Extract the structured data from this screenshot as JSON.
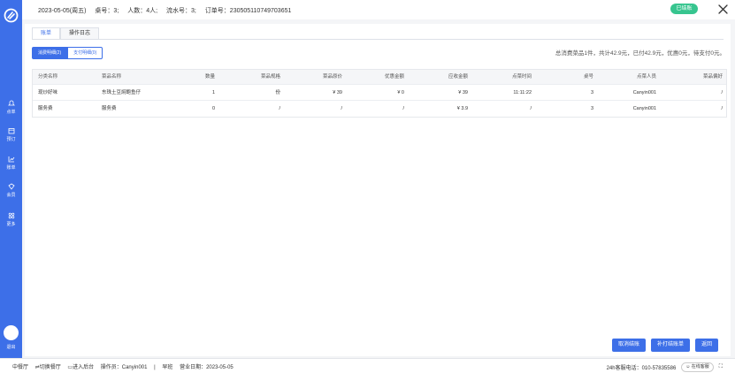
{
  "sidebar": {
    "items": [
      {
        "label": "点单",
        "icon": "bell-icon"
      },
      {
        "label": "预订",
        "icon": "calendar-icon"
      },
      {
        "label": "账单",
        "icon": "chart-icon"
      },
      {
        "label": "会员",
        "icon": "member-icon"
      },
      {
        "label": "更多",
        "icon": "grid-icon"
      }
    ],
    "logout": "退出"
  },
  "header": {
    "date": "2023-05-05(周五)",
    "table_no": "桌号：3;",
    "guests": "人数：4人;",
    "serial": "流水号：3;",
    "order_no": "订单号：230505110749703651",
    "status": "已结账"
  },
  "tabs": [
    "账单",
    "操作日志"
  ],
  "subtabs": [
    "消费明细(2)",
    "支付明细(0)"
  ],
  "summary": "总消费菜品1件，共计42.9元，已付42.9元，优惠0元，待支付0元。",
  "table": {
    "columns": [
      "分类名称",
      "菜品名称",
      "数量",
      "菜品规格",
      "菜品原价",
      "优惠金额",
      "应收金额",
      "点菜时间",
      "桌号",
      "点菜人员",
      "菜品偏好"
    ],
    "rows": [
      [
        "现炒好味",
        "东珠土豆焖鲍鱼仔",
        "1",
        "份",
        "¥ 39",
        "¥ 0",
        "¥ 39",
        "11:11:22",
        "3",
        "Canyin001",
        "/"
      ],
      [
        "服务费",
        "服务费",
        "0",
        "/",
        "/",
        "/",
        "¥ 3.9",
        "/",
        "3",
        "Canyin001",
        "/"
      ]
    ]
  },
  "actions": {
    "cancel": "取消结账",
    "reprint": "补打结账单",
    "back": "返回"
  },
  "footer": {
    "store": "中餐厅",
    "switch": "切换餐厅",
    "backend": "进入后台",
    "operator": "操作员：Canyin001",
    "shift": "早班",
    "business_date": "营业日期：2023-05-05",
    "hotline": "24h客服电话：010-57835586",
    "online": "在线客服"
  },
  "colors": {
    "primary": "#3d6fe8",
    "status": "#37c58f"
  }
}
